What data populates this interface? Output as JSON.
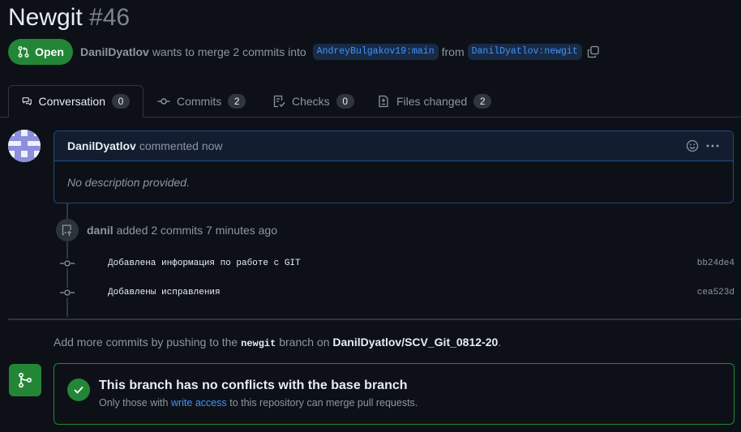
{
  "pr": {
    "title": "Newgit",
    "number": "#46",
    "state": "Open",
    "author": "DanilDyatlov",
    "merge_text": "wants to merge 2 commits into",
    "base_branch": "AndreyBulgakov19:main",
    "from_text": "from",
    "head_branch": "DanilDyatlov:newgit"
  },
  "tabs": [
    {
      "label": "Conversation",
      "count": "0"
    },
    {
      "label": "Commits",
      "count": "2"
    },
    {
      "label": "Checks",
      "count": "0"
    },
    {
      "label": "Files changed",
      "count": "2"
    }
  ],
  "comment": {
    "author": "DanilDyatlov",
    "action": "commented now",
    "body": "No description provided."
  },
  "event": {
    "user": "danil",
    "text": "added 2 commits 7 minutes ago"
  },
  "commits": [
    {
      "message": "Добавлена информация по работе с GIT",
      "sha": "bb24de4"
    },
    {
      "message": "Добавлены исправления",
      "sha": "cea523d"
    }
  ],
  "hint": {
    "prefix": "Add more commits by pushing to the",
    "branch": "newgit",
    "middle": "branch on",
    "repo": "DanilDyatlov/SCV_Git_0812-20",
    "suffix": "."
  },
  "merge": {
    "title": "This branch has no conflicts with the base branch",
    "sub_prefix": "Only those with",
    "link": "write access",
    "sub_suffix": "to this repository can merge pull requests."
  },
  "colors": {
    "background": "#0d1117",
    "open_green": "#238636",
    "link_blue": "#4493f8"
  }
}
